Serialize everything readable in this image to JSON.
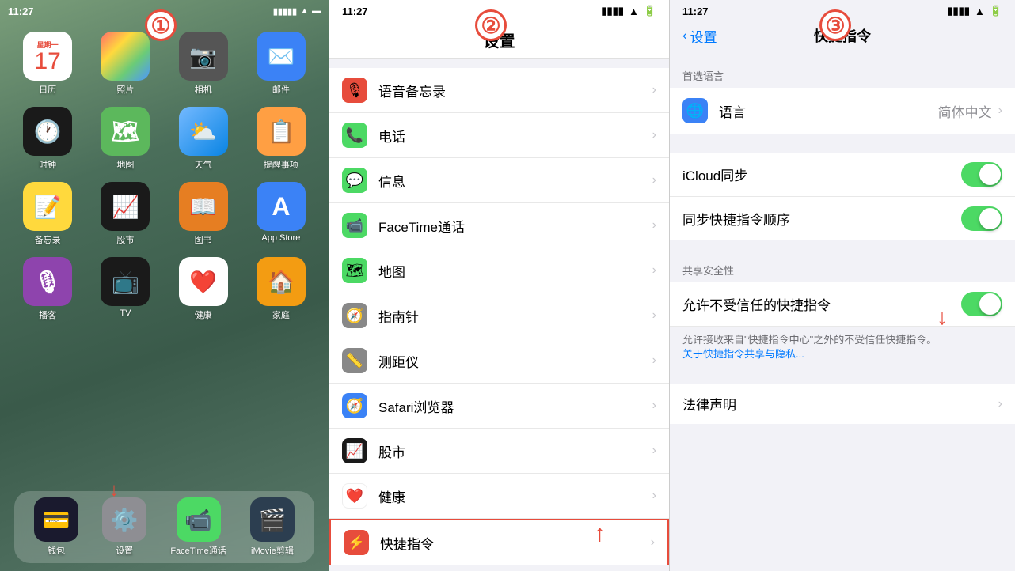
{
  "steps": {
    "step1_label": "①",
    "step2_label": "②",
    "step3_label": "③"
  },
  "panel1": {
    "time": "11:27",
    "apps": [
      {
        "label": "日历",
        "date": "17",
        "day": "星期一",
        "color_class": "app-calendar"
      },
      {
        "label": "照片",
        "icon": "🌄",
        "color_class": "app-photos"
      },
      {
        "label": "相机",
        "icon": "📷",
        "color_class": "app-camera"
      },
      {
        "label": "邮件",
        "icon": "✉️",
        "color_class": "app-mail"
      },
      {
        "label": "时钟",
        "icon": "🕐",
        "color_class": "app-clock"
      },
      {
        "label": "地图",
        "icon": "🗺",
        "color_class": "app-maps"
      },
      {
        "label": "天气",
        "icon": "⛅",
        "color_class": "app-weather"
      },
      {
        "label": "提醒事项",
        "icon": "📋",
        "color_class": "app-stocks"
      },
      {
        "label": "备忘录",
        "icon": "📝",
        "color_class": "app-notes"
      },
      {
        "label": "股市",
        "icon": "📈",
        "color_class": "app-stocks2"
      },
      {
        "label": "图书",
        "icon": "📖",
        "color_class": "app-ibooks"
      },
      {
        "label": "App Store",
        "icon": "A",
        "color_class": "app-appstore"
      },
      {
        "label": "播客",
        "icon": "🎙",
        "color_class": "app-podcasts"
      },
      {
        "label": "TV",
        "icon": "📺",
        "color_class": "app-appletv"
      },
      {
        "label": "健康",
        "icon": "❤️",
        "color_class": "app-health"
      },
      {
        "label": "家庭",
        "icon": "🏠",
        "color_class": "app-home"
      }
    ],
    "dock": [
      {
        "label": "钱包",
        "icon": "💳",
        "color_class": "app-wallet"
      },
      {
        "label": "设置",
        "icon": "⚙️",
        "color_class": "app-settings"
      },
      {
        "label": "FaceTime通话",
        "icon": "📹",
        "color_class": "app-facetime"
      },
      {
        "label": "iMovie剪辑",
        "icon": "🎬",
        "color_class": "app-imovie"
      }
    ]
  },
  "panel2": {
    "time": "11:27",
    "title": "设置",
    "settings_items": [
      {
        "icon": "🎙",
        "icon_bg": "#e74c3c",
        "label": "语音备忘录"
      },
      {
        "icon": "📞",
        "icon_bg": "#4cd964",
        "label": "电话"
      },
      {
        "icon": "💬",
        "icon_bg": "#4cd964",
        "label": "信息"
      },
      {
        "icon": "📹",
        "icon_bg": "#4cd964",
        "label": "FaceTime通话"
      },
      {
        "icon": "🗺",
        "icon_bg": "#4cd964",
        "label": "地图"
      },
      {
        "icon": "🧭",
        "icon_bg": "#888",
        "label": "指南针"
      },
      {
        "icon": "📏",
        "icon_bg": "#888",
        "label": "测距仪"
      },
      {
        "icon": "🧭",
        "icon_bg": "#3498db",
        "label": "Safari浏览器"
      },
      {
        "icon": "📈",
        "icon_bg": "#1a1a1a",
        "label": "股市"
      },
      {
        "icon": "❤️",
        "icon_bg": "#e74c3c",
        "label": "健康"
      },
      {
        "icon": "⚡",
        "icon_bg": "#e74c3c",
        "label": "快捷指令",
        "highlight": true
      }
    ]
  },
  "panel3": {
    "back_label": "设置",
    "title": "快捷指令",
    "section_preferred_lang": "首选语言",
    "lang_label": "语言",
    "lang_value": "简体中文",
    "icloud_sync_label": "iCloud同步",
    "sync_order_label": "同步快捷指令顺序",
    "section_shared_security": "共享安全性",
    "allow_untrusted_label": "允许不受信任的快捷指令",
    "description_text": "允许接收来自\"快捷指令中心\"之外的不受信任快捷指令。",
    "link_text": "关于快捷指令共享与隐私...",
    "legal_label": "法律声明"
  }
}
